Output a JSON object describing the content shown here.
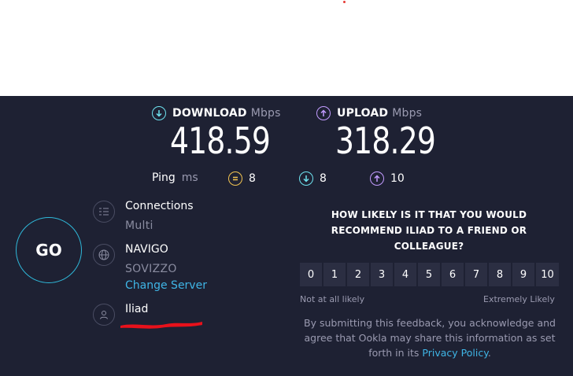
{
  "download": {
    "label": "DOWNLOAD",
    "unit": "Mbps",
    "value": "418.59"
  },
  "upload": {
    "label": "UPLOAD",
    "unit": "Mbps",
    "value": "318.29"
  },
  "ping": {
    "label": "Ping",
    "unit": "ms",
    "idle": "8",
    "download": "8",
    "upload": "10"
  },
  "go_label": "GO",
  "connections": {
    "title": "Connections",
    "value": "Multi"
  },
  "server": {
    "name": "NAVIGO",
    "location": "SOVIZZO",
    "change_label": "Change Server"
  },
  "provider": {
    "name": "Iliad"
  },
  "survey": {
    "question": "HOW LIKELY IS IT THAT YOU WOULD RECOMMEND ILIAD TO A FRIEND OR COLLEAGUE?",
    "scale": [
      "0",
      "1",
      "2",
      "3",
      "4",
      "5",
      "6",
      "7",
      "8",
      "9",
      "10"
    ],
    "low_label": "Not at all likely",
    "high_label": "Extremely Likely",
    "disclaimer_prefix": "By submitting this feedback, you acknowledge and agree that Ookla may share this information as set forth in its",
    "privacy_link": "Privacy Policy",
    "disclaimer_suffix": "."
  },
  "colors": {
    "panel_bg": "#1e2133",
    "download_accent": "#6ee3f0",
    "upload_accent": "#c29bff",
    "ping_accent": "#f3c551",
    "link": "#3fb5e6",
    "go_ring": "#2fb8d9"
  }
}
